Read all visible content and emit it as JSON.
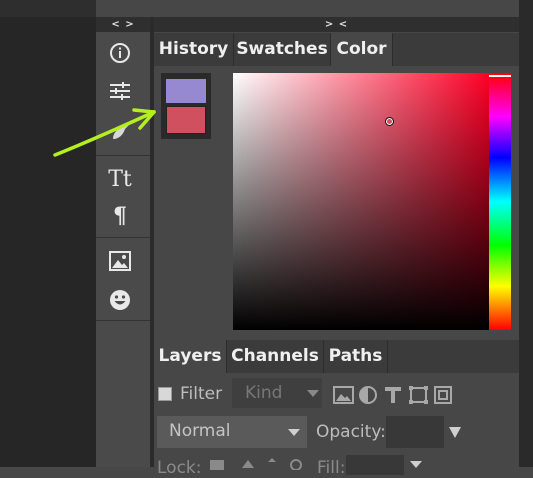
{
  "toolbar": {
    "collapse_label": "< >",
    "tools": [
      {
        "name": "info-icon"
      },
      {
        "name": "adjustments-icon"
      },
      {
        "name": "brush-icon"
      },
      {
        "name": "text-icon",
        "glyph": "Tt"
      },
      {
        "name": "paragraph-icon",
        "glyph": "¶"
      },
      {
        "name": "image-icon"
      },
      {
        "name": "emoji-icon"
      }
    ]
  },
  "color_panel": {
    "collapse_label": "> <",
    "tabs": [
      "History",
      "Swatches",
      "Color"
    ],
    "active_tab": "Color",
    "foreground_color": "#9689d2",
    "background_color": "#d05060",
    "picker_hue_color": "#ff0026"
  },
  "layers_panel": {
    "tabs": [
      "Layers",
      "Channels",
      "Paths"
    ],
    "active_tab": "Layers",
    "filter_label": "Filter",
    "kind_placeholder": "Kind",
    "blend_mode": "Normal",
    "opacity_label": "Opacity:",
    "lock_label": "Lock:",
    "fill_label": "Fill:"
  },
  "annotation": {
    "arrow_color": "#b4f01e"
  }
}
